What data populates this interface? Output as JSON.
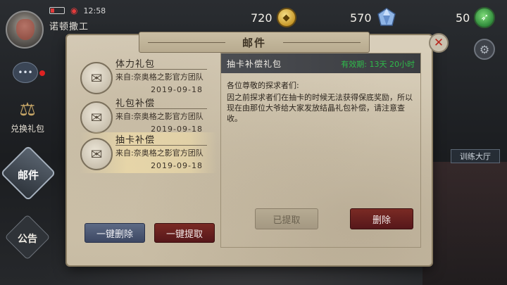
{
  "status": {
    "time": "12:58"
  },
  "player": {
    "name": "诺顿撒工"
  },
  "currency": {
    "coins": {
      "value": "720",
      "icon": "coin-icon"
    },
    "gems": {
      "value": "570",
      "icon": "gem-icon"
    },
    "energy": {
      "value": "50",
      "icon": "energy-icon"
    }
  },
  "sidebar": {
    "redeem_label": "兑换礼包",
    "mail_label": "邮件",
    "notice_label": "公告"
  },
  "right": {
    "train_hall_label": "训练大厅"
  },
  "mail_panel": {
    "title": "邮件",
    "items": [
      {
        "title": "体力礼包",
        "sender": "来自:奈奥格之影官方团队",
        "date": "2019-09-18",
        "selected": false
      },
      {
        "title": "礼包补偿",
        "sender": "来自:奈奥格之影官方团队",
        "date": "2019-09-18",
        "selected": false
      },
      {
        "title": "抽卡补偿",
        "sender": "来自:奈奥格之影官方团队",
        "date": "2019-09-18",
        "selected": true
      }
    ],
    "delete_all_label": "一键删除",
    "claim_all_label": "一键提取"
  },
  "detail": {
    "title": "抽卡补偿礼包",
    "expire": "有效期: 13天 20小时",
    "greeting": "各位尊敬的探求者们:",
    "body": "因之前探求者们在抽卡的时候无法获得保底奖励，所以现在由那位大爷给大家发放结晶礼包补偿，请注意查收。",
    "claimed_label": "已提取",
    "delete_label": "删除"
  },
  "colors": {
    "paper": "#cfc4ad",
    "red_button": "#6a2020",
    "blue_button": "#4d5a76",
    "expire_green": "#2fba4a"
  }
}
